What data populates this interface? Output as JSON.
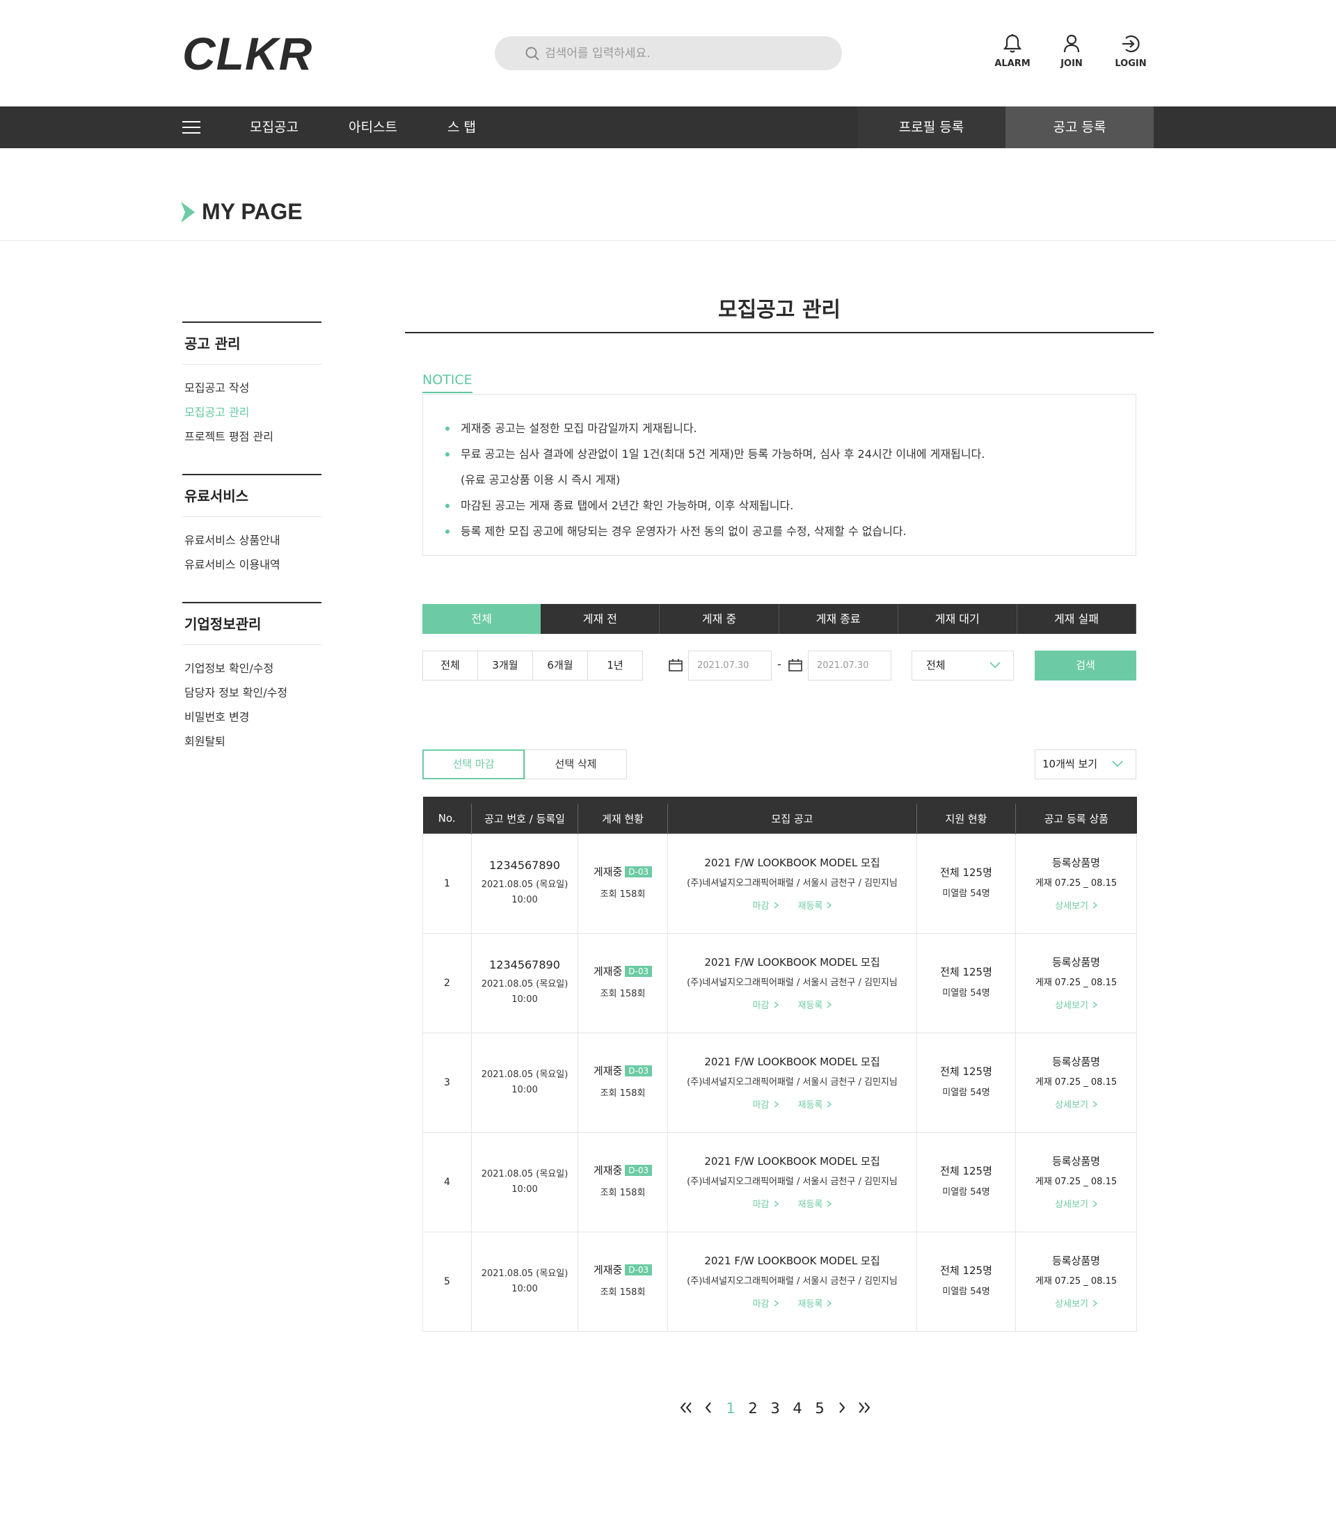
{
  "header": {
    "logo": "CLKR",
    "search_placeholder": "검색어를 입력하세요.",
    "alarm_label": "ALARM",
    "join_label": "JOIN",
    "login_label": "LOGIN"
  },
  "nav": {
    "items": [
      "모집공고",
      "아티스트",
      "스 탭"
    ],
    "profile_register": "프로필 등록",
    "post_register": "공고 등록"
  },
  "page_title": "MY PAGE",
  "sidebar": {
    "groups": [
      {
        "title": "공고 관리",
        "items": [
          "모집공고 작성",
          "모집공고 관리",
          "프로젝트 평점 관리"
        ]
      },
      {
        "title": "유료서비스",
        "items": [
          "유료서비스 상품안내",
          "유료서비스 이용내역"
        ]
      },
      {
        "title": "기업정보관리",
        "items": [
          "기업정보 확인/수정",
          "담당자 정보 확인/수정",
          "비밀번호 변경",
          "회원탈퇴"
        ]
      }
    ],
    "active_item": "모집공고 관리"
  },
  "main": {
    "title": "모집공고 관리",
    "notice_label": "NOTICE",
    "notices": [
      "게재중 공고는 설정한 모집 마감일까지 게재됩니다.",
      "무료 공고는 심사 결과에 상관없이 1일 1건(최대 5건 게재)만 등록 가능하며, 심사 후 24시간 이내에 게재됩니다.",
      "(유료 공고상품 이용 시 즉시 게재)",
      "마감된 공고는 게재 종료 탭에서 2년간 확인 가능하며, 이후 삭제됩니다.",
      "등록 제한 모집 공고에 해당되는 경우 운영자가 사전 동의 없이 공고를 수정, 삭제할 수 없습니다."
    ],
    "status_tabs": [
      "전체",
      "게재 전",
      "게재 중",
      "게재 종료",
      "게재 대기",
      "게재 실패"
    ],
    "period_buttons": [
      "전체",
      "3개월",
      "6개월",
      "1년"
    ],
    "date_from": "2021.07.30",
    "date_to": "2021.07.30",
    "date_separator": "-",
    "status_select": "전체",
    "search_button": "검색",
    "close_selected": "선택 마감",
    "delete_selected": "선택 삭제",
    "per_page": "10개씩 보기"
  },
  "table": {
    "headers": [
      "No.",
      "공고 번호 / 등록일",
      "게재 현황",
      "모집 공고",
      "지원 현황",
      "공고 등록 상품"
    ],
    "rows": [
      {
        "no": "1",
        "id": "1234567890",
        "date": "2021.08.05 (목요일)",
        "time": "10:00",
        "status": "게재중",
        "badge": "D-03",
        "views": "조회 158회",
        "title": "2021 F/W LOOKBOOK MODEL 모집",
        "meta": "(주)네셔널지오그래픽어패럴 / 서울시 금천구 / 김민지님",
        "link_close": "마감",
        "link_repost": "재등록",
        "apply_total": "전체 125명",
        "apply_unread": "미열람 54명",
        "product": "등록상품명",
        "product_period": "게재 07.25 _ 08.15",
        "detail": "상세보기"
      },
      {
        "no": "2",
        "id": "1234567890",
        "date": "2021.08.05 (목요일)",
        "time": "10:00",
        "status": "게재중",
        "badge": "D-03",
        "views": "조회 158회",
        "title": "2021 F/W LOOKBOOK MODEL 모집",
        "meta": "(주)네셔널지오그래픽어패럴 / 서울시 금천구 / 김민지님",
        "link_close": "마감",
        "link_repost": "재등록",
        "apply_total": "전체 125명",
        "apply_unread": "미열람 54명",
        "product": "등록상품명",
        "product_period": "게재 07.25 _ 08.15",
        "detail": "상세보기"
      },
      {
        "no": "3",
        "id": "",
        "date": "2021.08.05 (목요일)",
        "time": "10:00",
        "status": "게재중",
        "badge": "D-03",
        "views": "조회 158회",
        "title": "2021 F/W LOOKBOOK MODEL 모집",
        "meta": "(주)네셔널지오그래픽어패럴 / 서울시 금천구 / 김민지님",
        "link_close": "마감",
        "link_repost": "재등록",
        "apply_total": "전체 125명",
        "apply_unread": "미열람 54명",
        "product": "등록상품명",
        "product_period": "게재 07.25 _ 08.15",
        "detail": "상세보기"
      },
      {
        "no": "4",
        "id": "",
        "date": "2021.08.05 (목요일)",
        "time": "10:00",
        "status": "게재중",
        "badge": "D-03",
        "views": "조회 158회",
        "title": "2021 F/W LOOKBOOK MODEL 모집",
        "meta": "(주)네셔널지오그래픽어패럴 / 서울시 금천구 / 김민지님",
        "link_close": "마감",
        "link_repost": "재등록",
        "apply_total": "전체 125명",
        "apply_unread": "미열람 54명",
        "product": "등록상품명",
        "product_period": "게재 07.25 _ 08.15",
        "detail": "상세보기"
      },
      {
        "no": "5",
        "id": "",
        "date": "2021.08.05 (목요일)",
        "time": "10:00",
        "status": "게재중",
        "badge": "D-03",
        "views": "조회 158회",
        "title": "2021 F/W LOOKBOOK MODEL 모집",
        "meta": "(주)네셔널지오그래픽어패럴 / 서울시 금천구 / 김민지님",
        "link_close": "마감",
        "link_repost": "재등록",
        "apply_total": "전체 125명",
        "apply_unread": "미열람 54명",
        "product": "등록상품명",
        "product_period": "게재 07.25 _ 08.15",
        "detail": "상세보기"
      }
    ]
  },
  "pagination": {
    "pages": [
      "1",
      "2",
      "3",
      "4",
      "5"
    ],
    "current": "1"
  },
  "colors": {
    "accent": "#6ccba4",
    "dark": "#333333"
  }
}
